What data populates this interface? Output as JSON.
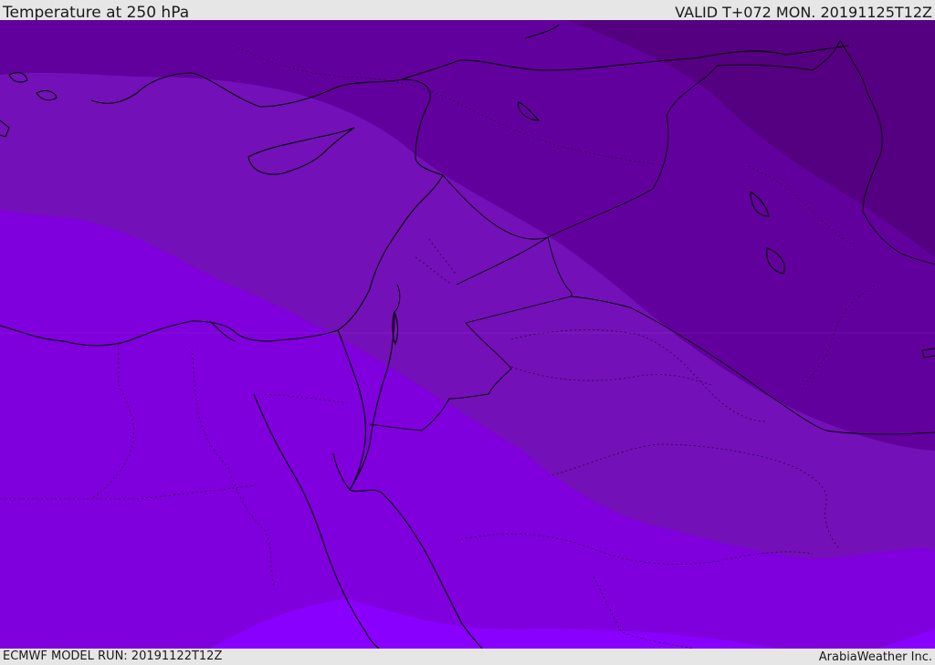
{
  "header": {
    "title": "Temperature at 250 hPa",
    "valid": "VALID T+072 MON. 20191125T12Z"
  },
  "footer": {
    "model_run": "ECMWF MODEL RUN: 20191122T12Z",
    "credit": "ArabiaWeather Inc."
  },
  "map": {
    "colors": {
      "band_darkest": "#550080",
      "band_dark": "#62009e",
      "band_mid": "#7410b8",
      "band_main": "#7f00dc",
      "band_bright": "#8a00ff",
      "coastline": "#000000"
    }
  }
}
